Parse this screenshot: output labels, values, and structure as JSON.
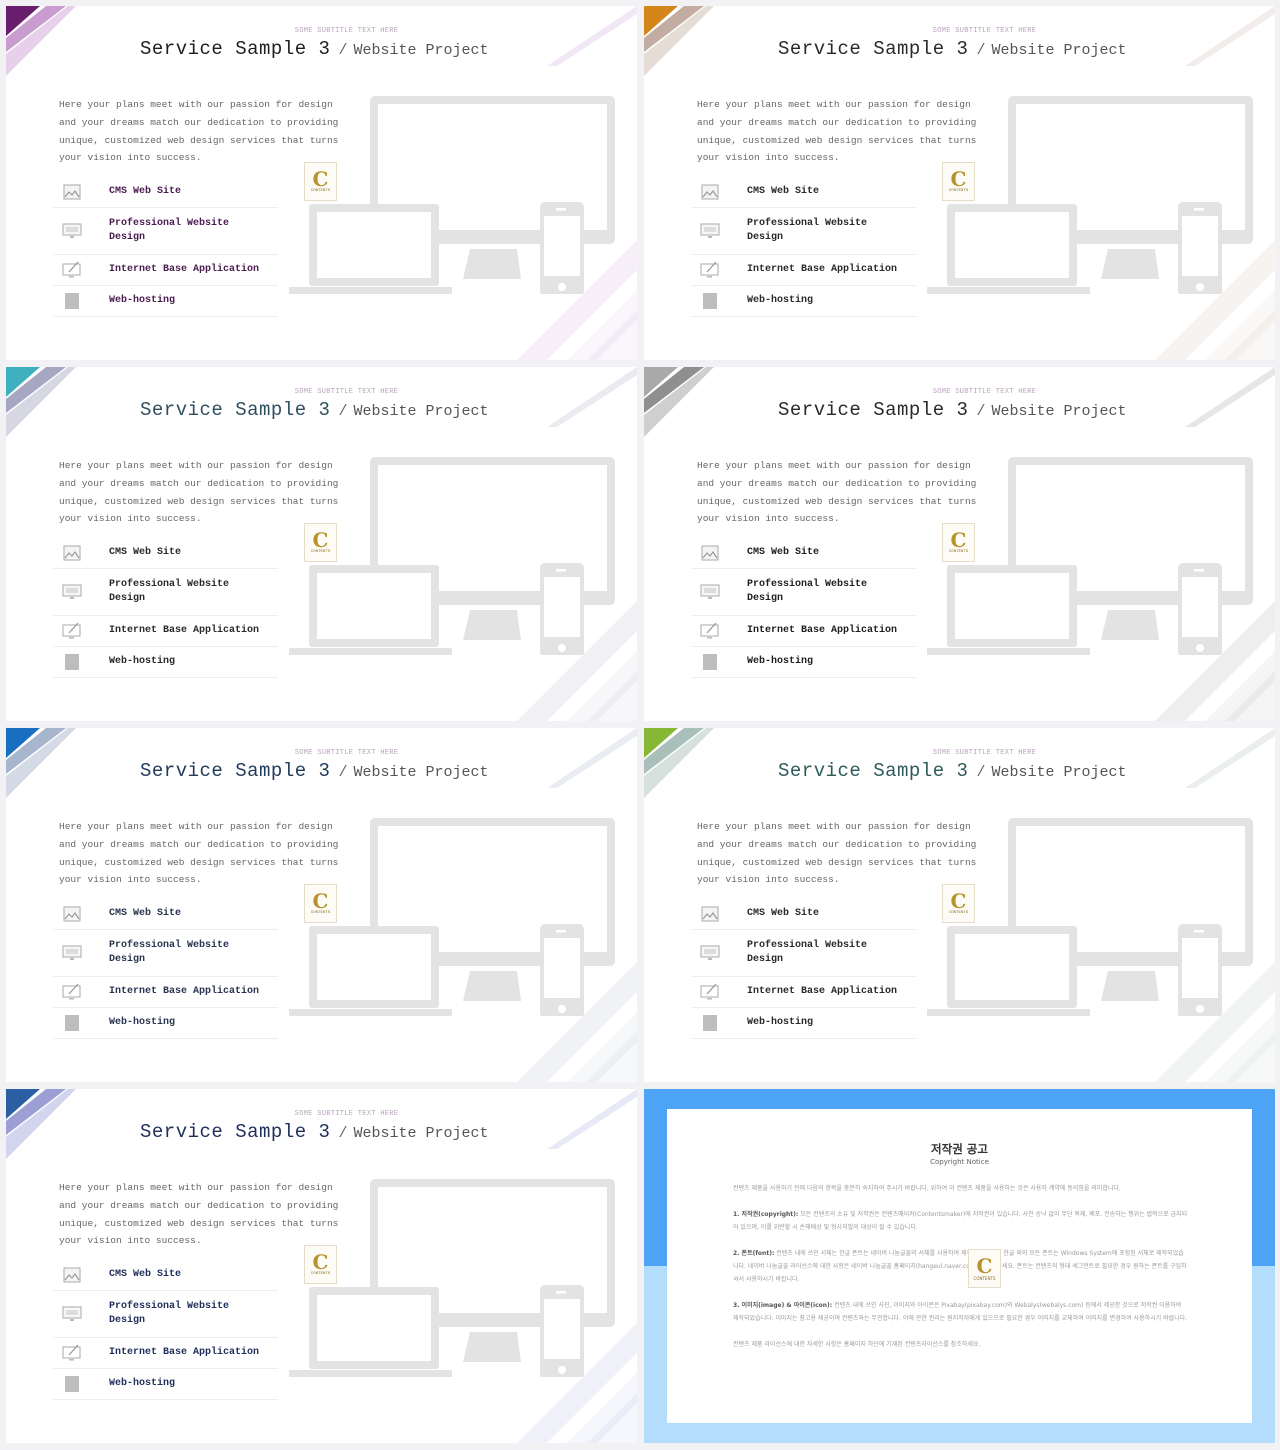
{
  "slide": {
    "subtitle": "SOME SUBTITLE TEXT HERE",
    "title_main": "Service Sample 3",
    "title_slash": "/",
    "title_sub": "Website Project",
    "description": "Here your plans meet with our passion for design and your dreams match our dedication to providing unique, customized web design services that turns your vision into success.",
    "services": [
      {
        "icon": "image-icon",
        "label": "CMS Web Site"
      },
      {
        "icon": "monitor-icon",
        "label": "Professional Website\nDesign"
      },
      {
        "icon": "edit-screen-icon",
        "label": "Internet Base Application"
      },
      {
        "icon": "server-icon",
        "label": "Web-hosting"
      }
    ],
    "logo_letter": "C",
    "logo_text": "CONTENTS"
  },
  "themes": [
    {
      "name": "purple",
      "accent1": "#6a1f6e",
      "accent2": "#c89ccf",
      "accent3": "#e6d0ea",
      "title_color": "#1e1e1e",
      "label_color": "#4a1c50"
    },
    {
      "name": "orange",
      "accent1": "#d4861a",
      "accent2": "#c3aca2",
      "accent3": "#e6dcd6",
      "title_color": "#2a2a2a",
      "label_color": "#2a2a2a"
    },
    {
      "name": "teal",
      "accent1": "#3fb0bd",
      "accent2": "#a7a7c4",
      "accent3": "#d6d7e2",
      "title_color": "#2f4f5f",
      "label_color": "#2a2a2a"
    },
    {
      "name": "gray",
      "accent1": "#a9a9a9",
      "accent2": "#8f8f8f",
      "accent3": "#cfcfcf",
      "title_color": "#2a2a2a",
      "label_color": "#1e1e1e"
    },
    {
      "name": "blue",
      "accent1": "#1a6ec2",
      "accent2": "#a7b6cc",
      "accent3": "#d4dbe6",
      "title_color": "#1f3a5a",
      "label_color": "#2a3550"
    },
    {
      "name": "green",
      "accent1": "#86b835",
      "accent2": "#a9bfba",
      "accent3": "#d6e0dd",
      "title_color": "#2e5a5a",
      "label_color": "#2a2a2a"
    },
    {
      "name": "navy",
      "accent1": "#2b5ea3",
      "accent2": "#9b9fd4",
      "accent3": "#d3d5ee",
      "title_color": "#1e2f5a",
      "label_color": "#1e2f5a"
    }
  ],
  "copyright": {
    "title": "저작권 공고",
    "subtitle": "Copyright Notice",
    "intro": "컨텐츠 제품을 사용하기 전에 다음의 항목을 충분히 숙지하여 주시기 바랍니다. 위하여 이 컨텐츠 제품을 사용하는 것은 사용자 계약에 동의함을 의미합니다.",
    "item1_head": "1. 저작권(copyright):",
    "item1_body": "모든 컨텐츠의 소유 및 저작권은 컨텐츠메이커(Contentsmaker)에 저작권이 있습니다. 사전 승낙 없이 무단 복제, 배포, 전송하는 행위는 법적으로 금지되어 있으며, 이를 위반할 시 손해배상 및 형사처벌의 대상이 될 수 있습니다.",
    "item2_head": "2. 폰트(font):",
    "item2_body": "컨텐츠 내에 쓰인 서체는 한글 폰트는 네이버 나눔글꼴의 서체를 사용하여 제작되었습니다. 한글 외의 모든 폰트는 Windows System에 포함된 서체로 제작되었습니다. 네이버 나눔글꼴 라이선스에 대한 사항은 네이버 나눔글꼴 홈페이지(hangeul.naver.com)를 참조하세요. 폰트는 컨텐츠의 형태 세그먼트로 필요한 경우 원하는 폰트를 구입하셔서 사용하시기 바랍니다.",
    "item3_head": "3. 이미지(image) & 아이콘(icon):",
    "item3_body": "컨텐츠 내에 쓰인 사진, 이미지와 아이콘은 Pixabay(pixabay.com)와 Webalys(webalys.com) 등에서 제공한 것으로 저작권 이용하여 제작되었습니다. 이미지는 참고용 제공이며 컨텐츠와는 무관합니다. 이에 관한 권리는 원저작자에게 있으므로 필요한 경우 이미지를 교체하여 이미지를 변경하여 사용하시기 바랍니다.",
    "outro": "컨텐츠 제품 라이선스에 대한 자세한 사항은 홈페이지 하단에 기재된 컨텐츠라이선스를 참조하세요."
  }
}
